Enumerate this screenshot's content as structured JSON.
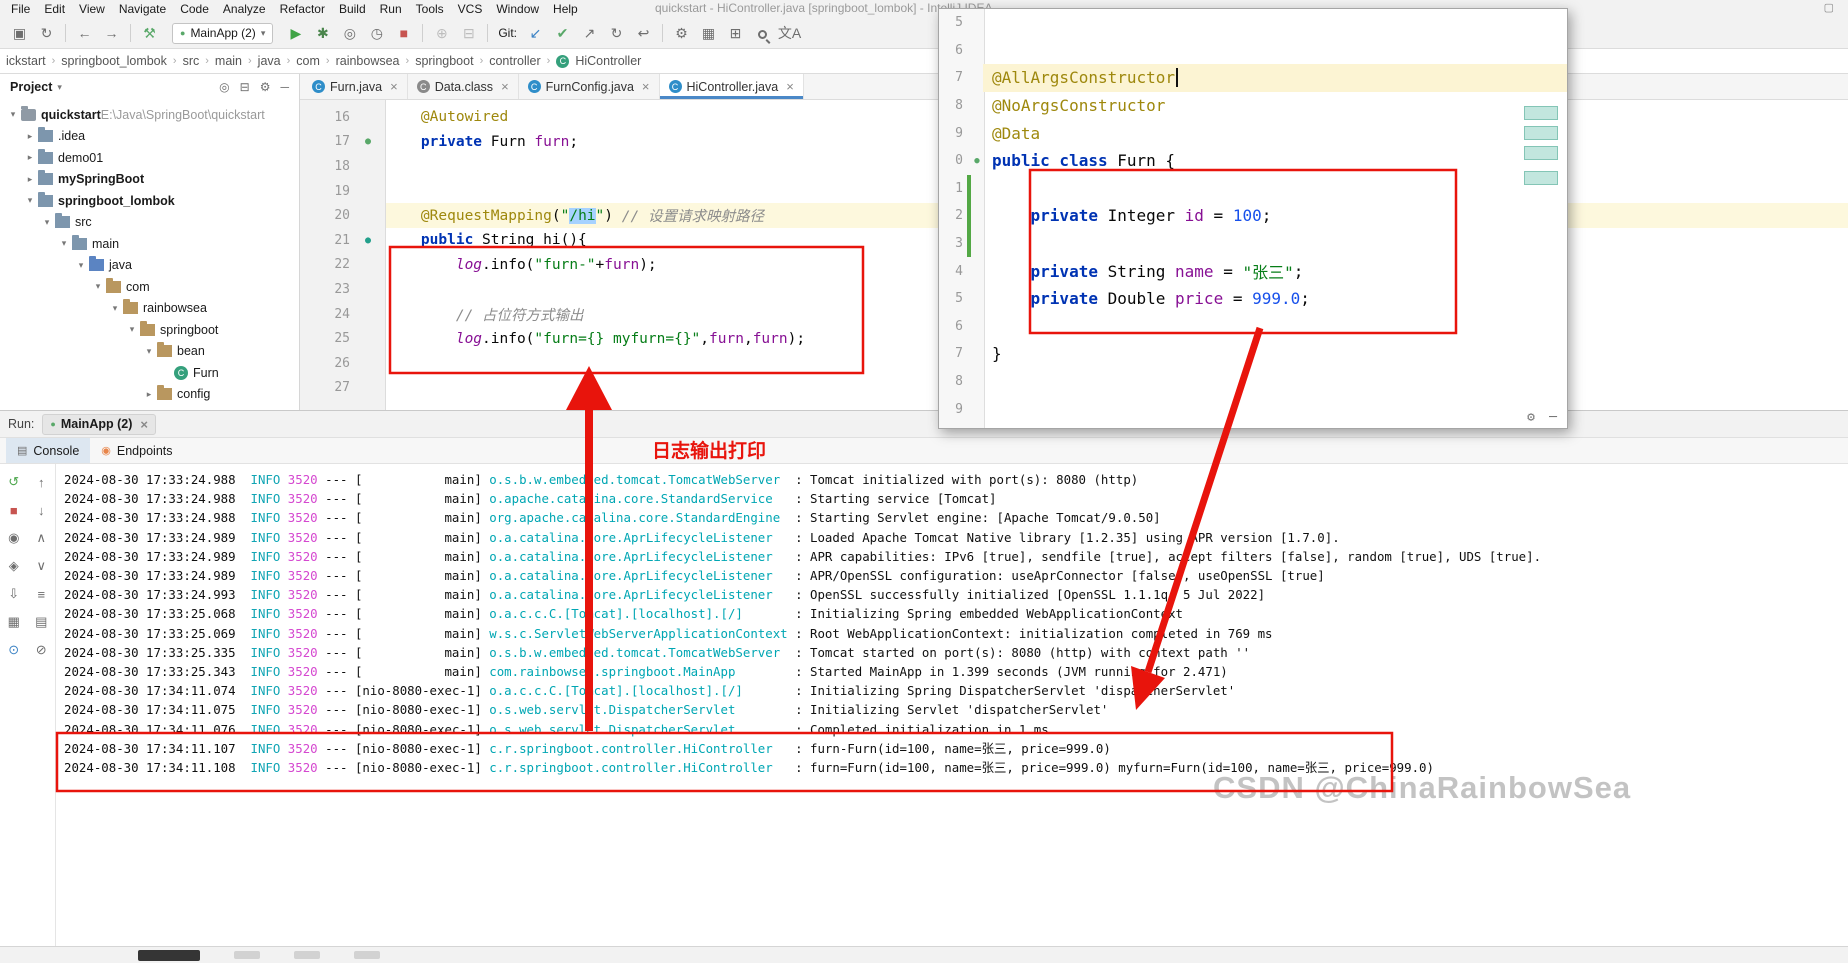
{
  "window": {
    "title": "quickstart - HiController.java [springboot_lombok] - IntelliJ IDEA",
    "menu": [
      "File",
      "Edit",
      "View",
      "Navigate",
      "Code",
      "Analyze",
      "Refactor",
      "Build",
      "Run",
      "Tools",
      "VCS",
      "Window",
      "Help"
    ]
  },
  "toolbar": {
    "git_label": "Git:",
    "items": [
      {
        "name": "save-icon",
        "g": "▣"
      },
      {
        "name": "sync-icon",
        "g": "↻"
      },
      {
        "sep": true
      },
      {
        "name": "back-icon",
        "g": "←"
      },
      {
        "name": "forward-icon",
        "g": "→"
      },
      {
        "sep": true
      },
      {
        "name": "build-hammer-icon",
        "g": "⚒",
        "c": "#59a869"
      },
      {
        "combo": true,
        "name": "run-config-combo",
        "label": "MainApp (2)"
      },
      {
        "name": "run-icon",
        "g": "▶",
        "c": "#3fa345"
      },
      {
        "name": "debug-icon",
        "g": "✱",
        "c": "#4a854c"
      },
      {
        "name": "coverage-icon",
        "g": "◎"
      },
      {
        "name": "profiler-icon",
        "g": "◷"
      },
      {
        "name": "stop-icon",
        "g": "■",
        "c": "#c75450"
      },
      {
        "sep": true
      },
      {
        "name": "attach-icon",
        "g": "⊕",
        "c": "#bdbdbd"
      },
      {
        "name": "dump-icon",
        "g": "⊟",
        "c": "#bdbdbd"
      },
      {
        "sep": true
      },
      {
        "label_git": true
      },
      {
        "name": "git-update-icon",
        "g": "↙",
        "c": "#3b82c4"
      },
      {
        "name": "git-commit-icon",
        "g": "✔",
        "c": "#59a869"
      },
      {
        "name": "git-push-icon",
        "g": "↗"
      },
      {
        "name": "git-history-icon",
        "g": "↻"
      },
      {
        "name": "git-rollback-icon",
        "g": "↩"
      },
      {
        "sep": true
      },
      {
        "name": "settings-wrench-icon",
        "g": "⚙"
      },
      {
        "name": "structure-icon",
        "g": "▦"
      },
      {
        "name": "window-icon",
        "g": "⊞"
      },
      {
        "mag": true,
        "name": "search-icon"
      },
      {
        "name": "translate-icon",
        "g": "文A"
      }
    ]
  },
  "breadcrumb": [
    "ickstart",
    "springboot_lombok",
    "src",
    "main",
    "java",
    "com",
    "rainbowsea",
    "springboot",
    "controller",
    "HiController"
  ],
  "project": {
    "header": "Project",
    "tree": [
      {
        "label": "quickstart",
        "path": "E:\\Java\\SpringBoot\\quickstart",
        "indent": 0,
        "icon": "project",
        "bold": true,
        "exp": true
      },
      {
        "label": ".idea",
        "indent": 1,
        "icon": "folder",
        "exp": false
      },
      {
        "label": "demo01",
        "indent": 1,
        "icon": "folder",
        "exp": false
      },
      {
        "label": "mySpringBoot",
        "indent": 1,
        "icon": "folder",
        "bold": true,
        "exp": false
      },
      {
        "label": "springboot_lombok",
        "indent": 1,
        "icon": "folder",
        "bold": true,
        "exp": true
      },
      {
        "label": "src",
        "indent": 2,
        "icon": "folder",
        "exp": true
      },
      {
        "label": "main",
        "indent": 3,
        "icon": "folder",
        "exp": true
      },
      {
        "label": "java",
        "indent": 4,
        "icon": "src",
        "exp": true
      },
      {
        "label": "com",
        "indent": 5,
        "icon": "pkg",
        "exp": true
      },
      {
        "label": "rainbowsea",
        "indent": 6,
        "icon": "pkg",
        "exp": true
      },
      {
        "label": "springboot",
        "indent": 7,
        "icon": "pkg",
        "exp": true
      },
      {
        "label": "bean",
        "indent": 8,
        "icon": "pkg",
        "exp": true
      },
      {
        "label": "Furn",
        "indent": 9,
        "icon": "class"
      },
      {
        "label": "config",
        "indent": 8,
        "icon": "pkg",
        "exp": false
      }
    ]
  },
  "tabs": [
    {
      "label": "Furn.java",
      "gray": false,
      "active": false
    },
    {
      "label": "Data.class",
      "gray": true,
      "active": false
    },
    {
      "label": "FurnConfig.java",
      "gray": false,
      "active": false
    },
    {
      "label": "HiController.java",
      "gray": false,
      "active": true
    }
  ],
  "code": {
    "lines": [
      {
        "n": "16",
        "t": [
          [
            "ann",
            "    @Autowired"
          ]
        ]
      },
      {
        "n": "17",
        "gicon": "bean",
        "t": [
          [
            "kw",
            "    private "
          ],
          [
            "pl",
            "Furn "
          ],
          [
            "fld",
            "furn"
          ],
          [
            "pl",
            ";"
          ]
        ]
      },
      {
        "n": "18",
        "t": []
      },
      {
        "n": "19",
        "t": []
      },
      {
        "n": "20",
        "hl": true,
        "t": [
          [
            "ann",
            "    @RequestMapping"
          ],
          [
            "pl",
            "("
          ],
          [
            "str",
            "\""
          ],
          [
            "strsel",
            "/hi"
          ],
          [
            "str",
            "\""
          ],
          [
            "pl",
            ") "
          ],
          [
            "cmt",
            "// 设置请求映射路径"
          ]
        ]
      },
      {
        "n": "21",
        "gicon": "mapping",
        "t": [
          [
            "kw",
            "    public "
          ],
          [
            "pl",
            "String hi(){"
          ]
        ]
      },
      {
        "n": "22",
        "t": [
          [
            "lg",
            "        log"
          ],
          [
            "pl",
            ".info("
          ],
          [
            "str",
            "\"furn-\""
          ],
          [
            "pl",
            "+"
          ],
          [
            "fld",
            "furn"
          ],
          [
            "pl",
            ");"
          ]
        ]
      },
      {
        "n": "23",
        "t": []
      },
      {
        "n": "24",
        "t": [
          [
            "cmt",
            "        // 占位符方式输出"
          ]
        ]
      },
      {
        "n": "25",
        "t": [
          [
            "lg",
            "        log"
          ],
          [
            "pl",
            ".info("
          ],
          [
            "str",
            "\"furn={} myfurn={}\""
          ],
          [
            "pl",
            ","
          ],
          [
            "fld",
            "furn"
          ],
          [
            "pl",
            ","
          ],
          [
            "fld",
            "furn"
          ],
          [
            "pl",
            ");"
          ]
        ]
      },
      {
        "n": "26",
        "t": []
      },
      {
        "n": "27",
        "t": []
      }
    ]
  },
  "popup": {
    "lines": [
      {
        "n": "5",
        "t": []
      },
      {
        "n": "6",
        "t": []
      },
      {
        "n": "7",
        "hl": true,
        "caret": true,
        "t": [
          [
            "ann",
            "@AllArgsConstructor"
          ]
        ]
      },
      {
        "n": "8",
        "t": [
          [
            "ann",
            "@NoArgsConstructor"
          ]
        ]
      },
      {
        "n": "9",
        "t": [
          [
            "ann",
            "@Data"
          ]
        ]
      },
      {
        "n": "0",
        "gicon": "bean",
        "t": [
          [
            "kw",
            "public class "
          ],
          [
            "pl",
            "Furn {"
          ]
        ]
      },
      {
        "n": "1",
        "chg": true,
        "t": []
      },
      {
        "n": "2",
        "chg": true,
        "t": [
          [
            "kw",
            "    private "
          ],
          [
            "pl",
            "Integer "
          ],
          [
            "fld",
            "id"
          ],
          [
            "pl",
            " = "
          ],
          [
            "num",
            "100"
          ],
          [
            "pl",
            ";"
          ]
        ]
      },
      {
        "n": "3",
        "chg": true,
        "t": []
      },
      {
        "n": "4",
        "t": [
          [
            "kw",
            "    private "
          ],
          [
            "pl",
            "String "
          ],
          [
            "fld",
            "name"
          ],
          [
            "pl",
            " = "
          ],
          [
            "str",
            "\"张三\""
          ],
          [
            "pl",
            ";"
          ]
        ]
      },
      {
        "n": "5",
        "t": [
          [
            "kw",
            "    private "
          ],
          [
            "pl",
            "Double "
          ],
          [
            "fld",
            "price"
          ],
          [
            "pl",
            " = "
          ],
          [
            "num",
            "999.0"
          ],
          [
            "pl",
            ";"
          ]
        ]
      },
      {
        "n": "6",
        "t": []
      },
      {
        "n": "7",
        "t": [
          [
            "pl",
            "}"
          ]
        ]
      },
      {
        "n": "8",
        "t": []
      },
      {
        "n": "9",
        "t": []
      }
    ]
  },
  "run": {
    "label": "Run:",
    "tab": "MainApp (2)",
    "tools": [
      {
        "label": "Console",
        "active": true,
        "icon": "console-icon",
        "g": "▤"
      },
      {
        "label": "Endpoints",
        "active": false,
        "icon": "endpoints-icon",
        "g": "◉",
        "orange": true
      }
    ],
    "strip1": [
      {
        "name": "rerun-icon",
        "g": "↺",
        "c": "#4ca64c"
      },
      {
        "name": "stop-icon",
        "g": "■",
        "c": "#c75450"
      },
      {
        "name": "camera-icon",
        "g": "◉"
      },
      {
        "name": "coverage-icon",
        "g": "◈"
      },
      {
        "name": "import-icon",
        "g": "⇩"
      },
      {
        "name": "grid-icon",
        "g": "▦"
      },
      {
        "name": "pin-icon",
        "g": "⊙",
        "c": "#3b82c4"
      }
    ],
    "strip2": [
      {
        "name": "up-icon",
        "g": "↑"
      },
      {
        "name": "down-icon",
        "g": "↓"
      },
      {
        "name": "expand-all-icon",
        "g": "∧"
      },
      {
        "name": "collapse-all-icon",
        "g": "∨"
      },
      {
        "name": "soft-wrap-icon",
        "g": "≡"
      },
      {
        "name": "print-icon",
        "g": "▤"
      },
      {
        "name": "clear-icon",
        "g": "⊘"
      }
    ]
  },
  "console": {
    "lines": [
      {
        "ts": "2024-08-30 17:33:24.988",
        "lv": "INFO",
        "pid": "3520",
        "th": "main",
        "lg": "o.s.b.w.embedded.tomcat.TomcatWebServer",
        "msg": "Tomcat initialized with port(s): 8080 (http)"
      },
      {
        "ts": "2024-08-30 17:33:24.988",
        "lv": "INFO",
        "pid": "3520",
        "th": "main",
        "lg": "o.apache.catalina.core.StandardService",
        "msg": "Starting service [Tomcat]"
      },
      {
        "ts": "2024-08-30 17:33:24.988",
        "lv": "INFO",
        "pid": "3520",
        "th": "main",
        "lg": "org.apache.catalina.core.StandardEngine",
        "msg": "Starting Servlet engine: [Apache Tomcat/9.0.50]"
      },
      {
        "ts": "2024-08-30 17:33:24.989",
        "lv": "INFO",
        "pid": "3520",
        "th": "main",
        "lg": "o.a.catalina.core.AprLifecycleListener",
        "msg": "Loaded Apache Tomcat Native library [1.2.35] using APR version [1.7.0]."
      },
      {
        "ts": "2024-08-30 17:33:24.989",
        "lv": "INFO",
        "pid": "3520",
        "th": "main",
        "lg": "o.a.catalina.core.AprLifecycleListener",
        "msg": "APR capabilities: IPv6 [true], sendfile [true], accept filters [false], random [true], UDS [true]."
      },
      {
        "ts": "2024-08-30 17:33:24.989",
        "lv": "INFO",
        "pid": "3520",
        "th": "main",
        "lg": "o.a.catalina.core.AprLifecycleListener",
        "msg": "APR/OpenSSL configuration: useAprConnector [false], useOpenSSL [true]"
      },
      {
        "ts": "2024-08-30 17:33:24.993",
        "lv": "INFO",
        "pid": "3520",
        "th": "main",
        "lg": "o.a.catalina.core.AprLifecycleListener",
        "msg": "OpenSSL successfully initialized [OpenSSL 1.1.1q  5 Jul 2022]"
      },
      {
        "ts": "2024-08-30 17:33:25.068",
        "lv": "INFO",
        "pid": "3520",
        "th": "main",
        "lg": "o.a.c.c.C.[Tomcat].[localhost].[/]",
        "msg": "Initializing Spring embedded WebApplicationContext"
      },
      {
        "ts": "2024-08-30 17:33:25.069",
        "lv": "INFO",
        "pid": "3520",
        "th": "main",
        "lg": "w.s.c.ServletWebServerApplicationContext",
        "msg": "Root WebApplicationContext: initialization completed in 769 ms"
      },
      {
        "ts": "2024-08-30 17:33:25.335",
        "lv": "INFO",
        "pid": "3520",
        "th": "main",
        "lg": "o.s.b.w.embedded.tomcat.TomcatWebServer",
        "msg": "Tomcat started on port(s): 8080 (http) with context path ''"
      },
      {
        "ts": "2024-08-30 17:33:25.343",
        "lv": "INFO",
        "pid": "3520",
        "th": "main",
        "lg": "com.rainbowsea.springboot.MainApp",
        "msg": "Started MainApp in 1.399 seconds (JVM running for 2.471)"
      },
      {
        "ts": "2024-08-30 17:34:11.074",
        "lv": "INFO",
        "pid": "3520",
        "th": "nio-8080-exec-1",
        "lg": "o.a.c.c.C.[Tomcat].[localhost].[/]",
        "msg": "Initializing Spring DispatcherServlet 'dispatcherServlet'"
      },
      {
        "ts": "2024-08-30 17:34:11.075",
        "lv": "INFO",
        "pid": "3520",
        "th": "nio-8080-exec-1",
        "lg": "o.s.web.servlet.DispatcherServlet",
        "msg": "Initializing Servlet 'dispatcherServlet'"
      },
      {
        "ts": "2024-08-30 17:34:11.076",
        "lv": "INFO",
        "pid": "3520",
        "th": "nio-8080-exec-1",
        "lg": "o.s.web.servlet.DispatcherServlet",
        "msg": "Completed initialization in 1 ms"
      },
      {
        "ts": "2024-08-30 17:34:11.107",
        "lv": "INFO",
        "pid": "3520",
        "th": "nio-8080-exec-1",
        "lg": "c.r.springboot.controller.HiController",
        "msg": "furn-Furn(id=100, name=张三, price=999.0)"
      },
      {
        "ts": "2024-08-30 17:34:11.108",
        "lv": "INFO",
        "pid": "3520",
        "th": "nio-8080-exec-1",
        "lg": "c.r.springboot.controller.HiController",
        "msg": "furn=Furn(id=100, name=张三, price=999.0) myfurn=Furn(id=100, name=张三, price=999.0)"
      }
    ]
  },
  "annotation": {
    "label": "日志输出打印",
    "color": "#e8140c"
  },
  "watermark": "CSDN @ChinaRainbowSea"
}
